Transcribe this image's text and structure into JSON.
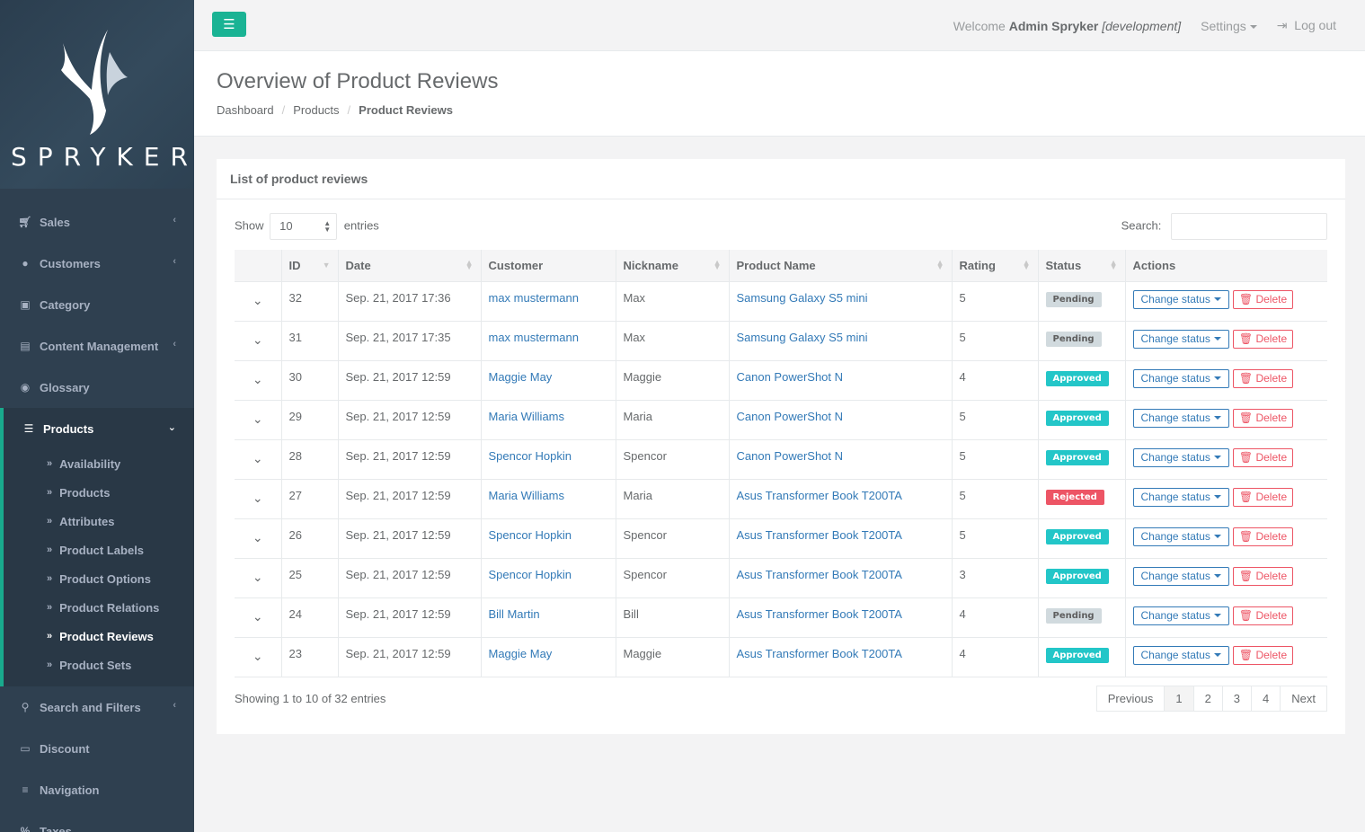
{
  "brand": {
    "name": "SPRYKER"
  },
  "topbar": {
    "welcome_prefix": "Welcome",
    "user": "Admin Spryker",
    "env": "[development]",
    "settings": "Settings",
    "logout": "Log out"
  },
  "sidebar": {
    "items": [
      {
        "label": "Sales"
      },
      {
        "label": "Customers"
      },
      {
        "label": "Category"
      },
      {
        "label": "Content Management"
      },
      {
        "label": "Glossary"
      },
      {
        "label": "Products"
      },
      {
        "label": "Search and Filters"
      },
      {
        "label": "Discount"
      },
      {
        "label": "Navigation"
      },
      {
        "label": "Taxes"
      }
    ],
    "sub_items": [
      {
        "label": "Availability"
      },
      {
        "label": "Products"
      },
      {
        "label": "Attributes"
      },
      {
        "label": "Product Labels"
      },
      {
        "label": "Product Options"
      },
      {
        "label": "Product Relations"
      },
      {
        "label": "Product Reviews"
      },
      {
        "label": "Product Sets"
      }
    ]
  },
  "page": {
    "title": "Overview of Product Reviews",
    "breadcrumb": [
      "Dashboard",
      "Products",
      "Product Reviews"
    ]
  },
  "box": {
    "title": "List of product reviews",
    "show_label": "Show",
    "entries_label": "entries",
    "length_value": "10",
    "search_label": "Search:",
    "search_value": ""
  },
  "table": {
    "headers": [
      "",
      "ID",
      "Date",
      "Customer",
      "Nickname",
      "Product Name",
      "Rating",
      "Status",
      "Actions"
    ],
    "change_status_label": "Change status",
    "delete_label": "Delete",
    "rows": [
      {
        "id": "32",
        "date": "Sep. 21, 2017 17:36",
        "customer": "max mustermann",
        "nickname": "Max",
        "product": "Samsung Galaxy S5 mini",
        "rating": "5",
        "status": "Pending"
      },
      {
        "id": "31",
        "date": "Sep. 21, 2017 17:35",
        "customer": "max mustermann",
        "nickname": "Max",
        "product": "Samsung Galaxy S5 mini",
        "rating": "5",
        "status": "Pending"
      },
      {
        "id": "30",
        "date": "Sep. 21, 2017 12:59",
        "customer": "Maggie May",
        "nickname": "Maggie",
        "product": "Canon PowerShot N",
        "rating": "4",
        "status": "Approved"
      },
      {
        "id": "29",
        "date": "Sep. 21, 2017 12:59",
        "customer": "Maria Williams",
        "nickname": "Maria",
        "product": "Canon PowerShot N",
        "rating": "5",
        "status": "Approved"
      },
      {
        "id": "28",
        "date": "Sep. 21, 2017 12:59",
        "customer": "Spencor Hopkin",
        "nickname": "Spencor",
        "product": "Canon PowerShot N",
        "rating": "5",
        "status": "Approved"
      },
      {
        "id": "27",
        "date": "Sep. 21, 2017 12:59",
        "customer": "Maria Williams",
        "nickname": "Maria",
        "product": "Asus Transformer Book T200TA",
        "rating": "5",
        "status": "Rejected"
      },
      {
        "id": "26",
        "date": "Sep. 21, 2017 12:59",
        "customer": "Spencor Hopkin",
        "nickname": "Spencor",
        "product": "Asus Transformer Book T200TA",
        "rating": "5",
        "status": "Approved"
      },
      {
        "id": "25",
        "date": "Sep. 21, 2017 12:59",
        "customer": "Spencor Hopkin",
        "nickname": "Spencor",
        "product": "Asus Transformer Book T200TA",
        "rating": "3",
        "status": "Approved"
      },
      {
        "id": "24",
        "date": "Sep. 21, 2017 12:59",
        "customer": "Bill Martin",
        "nickname": "Bill",
        "product": "Asus Transformer Book T200TA",
        "rating": "4",
        "status": "Pending"
      },
      {
        "id": "23",
        "date": "Sep. 21, 2017 12:59",
        "customer": "Maggie May",
        "nickname": "Maggie",
        "product": "Asus Transformer Book T200TA",
        "rating": "4",
        "status": "Approved"
      }
    ]
  },
  "footer": {
    "info": "Showing 1 to 10 of 32 entries",
    "previous": "Previous",
    "pages": [
      "1",
      "2",
      "3",
      "4"
    ],
    "next": "Next"
  },
  "colors": {
    "accent": "#1ab394",
    "sidebar": "#2f4050",
    "link": "#337ab7",
    "approved": "#23c6c8",
    "rejected": "#ed5565",
    "pending": "#d1dade"
  }
}
